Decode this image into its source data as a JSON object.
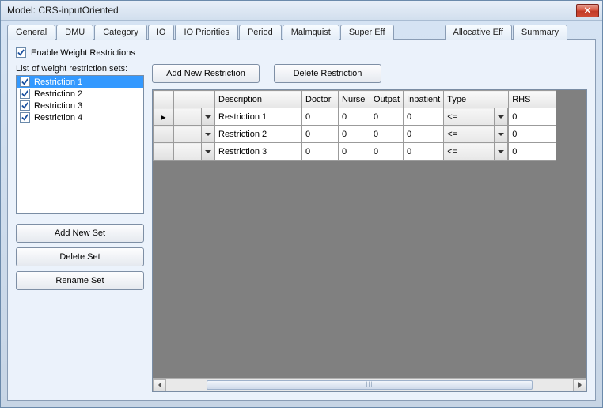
{
  "window": {
    "title": "Model: CRS-inputOriented"
  },
  "tabs": [
    "General",
    "DMU",
    "Category",
    "IO",
    "IO Priorities",
    "Period",
    "Malmquist",
    "Super Eff",
    "",
    "Allocative Eff",
    "Summary"
  ],
  "enable_checkbox": {
    "checked": true,
    "label": "Enable Weight Restrictions"
  },
  "sidebar": {
    "list_label": "List of weight restriction sets:",
    "items": [
      {
        "label": "Restriction 1",
        "checked": true,
        "selected": true
      },
      {
        "label": "Restriction 2",
        "checked": true,
        "selected": false
      },
      {
        "label": "Restriction 3",
        "checked": true,
        "selected": false
      },
      {
        "label": "Restriction 4",
        "checked": true,
        "selected": false
      }
    ],
    "buttons": {
      "add": "Add New Set",
      "delete": "Delete Set",
      "rename": "Rename Set"
    }
  },
  "right": {
    "buttons": {
      "add": "Add New Restriction",
      "delete": "Delete Restriction"
    },
    "grid": {
      "columns": [
        "",
        "",
        "Description",
        "Doctor",
        "Nurse",
        "Outpat",
        "Inpatient",
        "Type",
        "",
        "RHS"
      ],
      "rows": [
        {
          "current": true,
          "desc": "Restriction 1",
          "doctor": "0",
          "nurse": "0",
          "outpat": "0",
          "inpatient": "0",
          "type": "<=",
          "rhs": "0"
        },
        {
          "current": false,
          "desc": "Restriction 2",
          "doctor": "0",
          "nurse": "0",
          "outpat": "0",
          "inpatient": "0",
          "type": "<=",
          "rhs": "0"
        },
        {
          "current": false,
          "desc": "Restriction 3",
          "doctor": "0",
          "nurse": "0",
          "outpat": "0",
          "inpatient": "0",
          "type": "<=",
          "rhs": "0"
        }
      ]
    }
  }
}
